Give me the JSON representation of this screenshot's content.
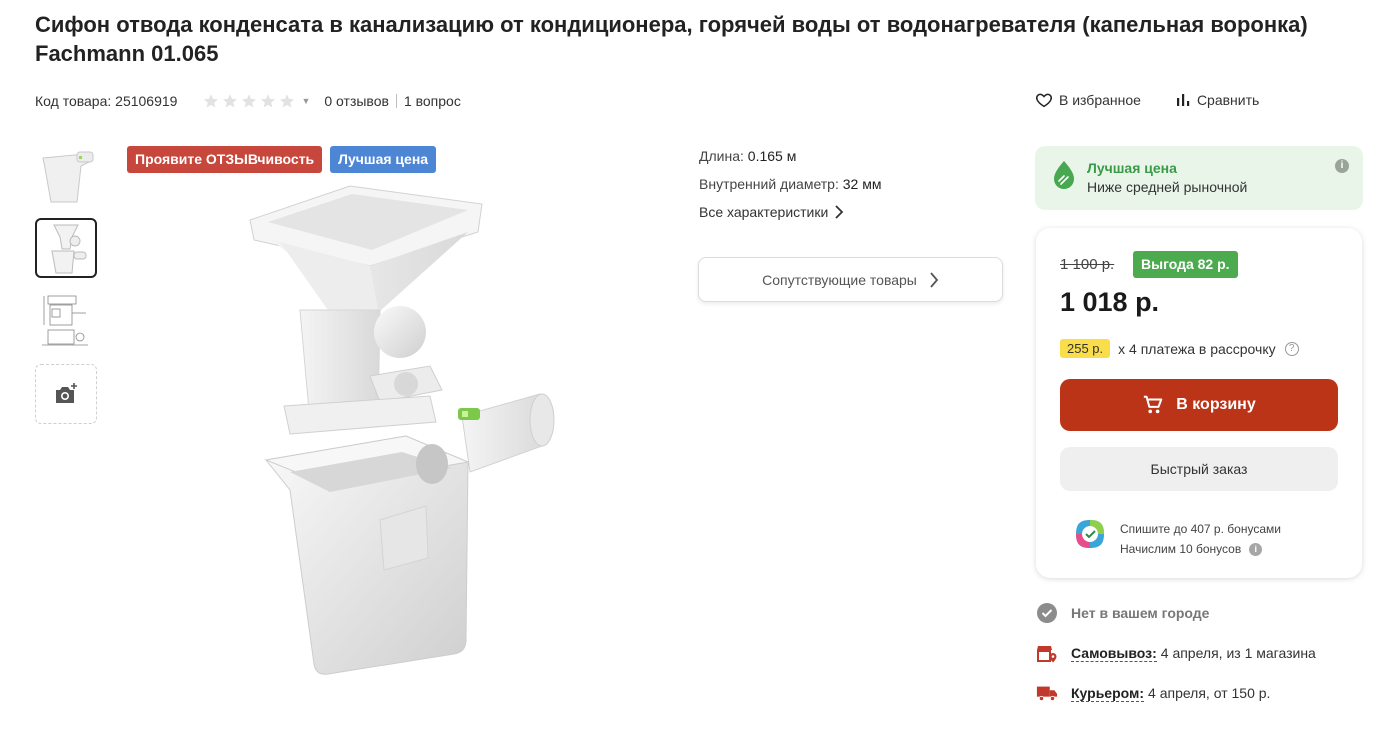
{
  "product": {
    "title": "Сифон отвода конденсата в канализацию от кондиционера, горячей воды от водонагревателя (капельная воронка) Fachmann 01.065"
  },
  "meta": {
    "sku_label": "Код товара:",
    "sku_value": "25106919",
    "rating": 0,
    "reviews": "0 отзывов",
    "questions": "1 вопрос"
  },
  "actions": {
    "favorite": "В избранное",
    "compare": "Сравнить"
  },
  "badges": {
    "promo": "Проявите ОТЗЫВчивость",
    "best": "Лучшая цена"
  },
  "specs": {
    "length_label": "Длина:",
    "length_value": "0.165 м",
    "diameter_label": "Внутренний диаметр:",
    "diameter_value": "32 мм",
    "all_link": "Все характеристики"
  },
  "related": {
    "label": "Сопутствующие товары"
  },
  "best_price": {
    "title": "Лучшая цена",
    "subtitle": "Ниже средней рыночной"
  },
  "price": {
    "old": "1 100 р.",
    "benefit": "Выгода 82 р.",
    "current": "1 018 р.",
    "installment_amount": "255 р.",
    "installment_text": "х 4 платежа в рассрочку",
    "cart_button": "В корзину",
    "quick_order": "Быстрый заказ",
    "bonus_spend": "Спишите до 407 р. бонусами",
    "bonus_earn": "Начислим 10 бонусов"
  },
  "delivery": {
    "availability": "Нет в вашем городе",
    "pickup_label": "Самовывоз:",
    "pickup_value": "4 апреля, из 1 магазина",
    "courier_label": "Курьером:",
    "courier_value": "4 апреля, от 150 р."
  },
  "colors": {
    "accent_red": "#bb3417",
    "benefit_green": "#4caa4f",
    "best_price_bg": "#eaf5ea",
    "badge_red": "#c8473d",
    "badge_blue": "#4e86d6",
    "installment_yellow": "#f9dd4a"
  },
  "icons": [
    "heart-icon",
    "compare-icon",
    "leaf-icon",
    "info-icon",
    "cart-icon",
    "help-icon",
    "bonus-logo-icon",
    "check-circle-icon",
    "store-pin-icon",
    "truck-icon",
    "chevron-right-icon",
    "camera-add-icon",
    "star-icon"
  ]
}
